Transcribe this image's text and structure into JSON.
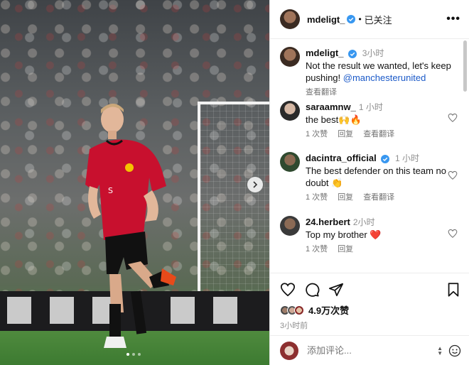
{
  "header": {
    "username": "mdeligt_",
    "separator": "•",
    "follow_status": "已关注",
    "more_label": "•••"
  },
  "caption": {
    "username": "mdeligt_",
    "time": "3小时",
    "text": "Not the result we wanted, let's keep pushing! ",
    "mention": "@manchesterunited",
    "translate": "查看翻译"
  },
  "comments": [
    {
      "username": "saraamnw_",
      "time": "1 小时",
      "text": "the best🙌🔥",
      "likes": "1 次赞",
      "reply": "回复",
      "translate": "查看翻译"
    },
    {
      "username": "dacintra_official",
      "time": "1 小时",
      "text": "The best defender on this team no doubt 👏",
      "likes": "1 次赞",
      "reply": "回复",
      "translate": "查看翻译"
    },
    {
      "username": "24.herbert",
      "time": "2小时",
      "text": "Top my brother ❤️",
      "likes": "1 次赞",
      "reply": "回复"
    }
  ],
  "actions": {
    "like_count": "4.9万次赞",
    "post_time": "3小时前"
  },
  "comment_box": {
    "placeholder": "添加评论..."
  },
  "icons": {
    "verified": "verified-badge-icon",
    "heart": "heart-icon",
    "comment": "comment-icon",
    "share": "share-icon",
    "bookmark": "bookmark-icon",
    "emoji": "emoji-icon",
    "next": "chevron-right-icon"
  },
  "colors": {
    "verified_blue": "#3897f0",
    "link_blue": "#1a59c8",
    "kit_red": "#c8102e"
  }
}
